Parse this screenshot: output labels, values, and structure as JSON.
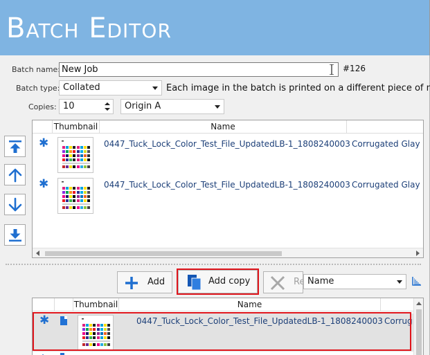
{
  "window": {
    "title": "Batch Editor"
  },
  "form": {
    "batch_name_label": "Batch name:",
    "batch_name_value": "New Job",
    "batch_number": "#126",
    "batch_type_label": "Batch type:",
    "batch_type_value": "Collated",
    "batch_type_description": "Each image in the batch is printed on a different piece of media",
    "copies_label": "Copies:",
    "copies_value": "10",
    "origin_value": "Origin A"
  },
  "top_table": {
    "columns": [
      "Thumbnail",
      "Name"
    ],
    "rows": [
      {
        "name": "0447_Tuck_Lock_Color_Test_File_UpdatedLB-1_1808240003",
        "media": "Corrugated Glay C"
      },
      {
        "name": "0447_Tuck_Lock_Color_Test_File_UpdatedLB-1_1808240003",
        "media": "Corrugated Glay C"
      }
    ]
  },
  "toolbar": {
    "add_label": "Add",
    "add_copy_label": "Add copy",
    "remove_label": "Re",
    "sort_value": "Name"
  },
  "bottom_table": {
    "columns": [
      "Thumbnail",
      "Name"
    ],
    "rows": [
      {
        "name": "0447_Tuck_Lock_Color_Test_File_UpdatedLB-1_1808240003",
        "media": "Corrug"
      }
    ]
  },
  "colors": {
    "title_bar": "#7fb4e2",
    "accent_blue": "#1f6fd0",
    "highlight_red": "#e0151c"
  },
  "icons": [
    "asterisk-icon",
    "move-to-top-icon",
    "move-up-icon",
    "move-down-icon",
    "move-to-bottom-icon",
    "plus-icon",
    "copy-icon",
    "remove-x-icon",
    "sort-icon",
    "file-icon",
    "chevron-down-icon"
  ]
}
